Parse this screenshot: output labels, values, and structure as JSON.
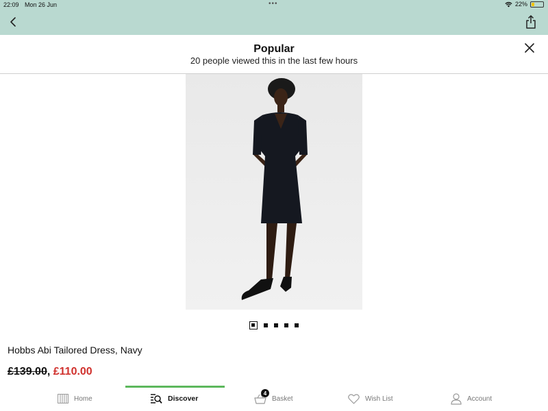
{
  "status_bar": {
    "time": "22:09",
    "date": "Mon 26 Jun",
    "dots": "•••",
    "battery": "22%",
    "battery_level": 0.22,
    "battery_color": "#f2c300"
  },
  "nav": {
    "back_icon": "chevron-left-icon",
    "share_icon": "share-icon",
    "bar_color": "#b9d9d0"
  },
  "popular": {
    "title": "Popular",
    "subtitle": "20 people viewed this in the last few hours",
    "close_icon": "close-icon"
  },
  "product": {
    "name": "Hobbs Abi Tailored Dress, Navy",
    "old_price": "£139.00",
    "separator": ",",
    "new_price": "£110.00",
    "sale_color": "#d0312d",
    "image_index": 1,
    "image_count": 5
  },
  "tabs": [
    {
      "label": "Home",
      "icon": "home-icon",
      "active": false
    },
    {
      "label": "Discover",
      "icon": "discover-icon",
      "active": true
    },
    {
      "label": "Basket",
      "icon": "basket-icon",
      "active": false,
      "badge": "4"
    },
    {
      "label": "Wish List",
      "icon": "heart-icon",
      "active": false
    },
    {
      "label": "Account",
      "icon": "user-icon",
      "active": false
    }
  ],
  "accent_color": "#5cb85c"
}
